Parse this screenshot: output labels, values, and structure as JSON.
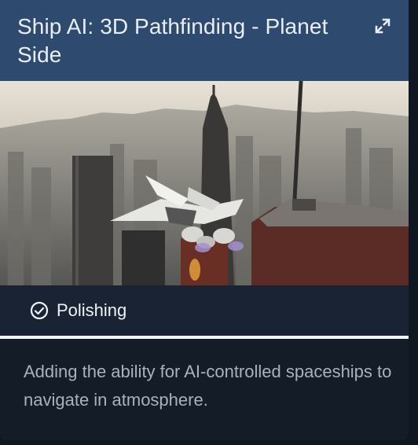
{
  "card": {
    "title": "Ship AI: 3D Pathfinding - Planet Side",
    "expand_icon": "external-link-icon",
    "image": "city-skyline-spaceship-image",
    "status": {
      "icon": "check-circle-icon",
      "label": "Polishing"
    },
    "description": "Adding the ability for AI-controlled spaceships to navigate in atmosphere."
  },
  "colors": {
    "header_bg": "#2e4a6e",
    "card_bg": "#141c27",
    "status_bg": "#1a2333",
    "divider": "#f2f4f7",
    "title_text": "#e8eef6",
    "description_text": "#a8b2bf"
  }
}
